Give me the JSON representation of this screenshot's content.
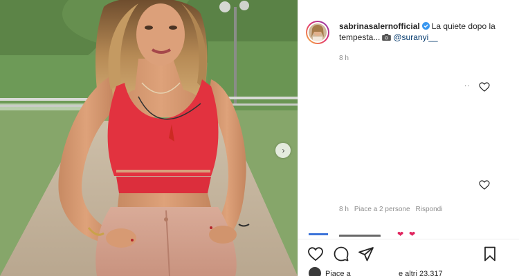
{
  "post": {
    "username": "sabrinasalernofficial",
    "caption_part1": "La quiete dopo la tempesta...",
    "mention": "@suranyi__",
    "timestamp": "8 h"
  },
  "comment": {
    "timestamp": "8 h",
    "likes": "Piace a 2 persone",
    "reply": "Rispondi"
  },
  "likes": {
    "prefix": "Piace a",
    "suffix": "e altri 23.317"
  },
  "icons": {
    "verified": "verified-badge-icon",
    "camera": "camera-icon",
    "next": "chevron-right-icon",
    "like": "heart-icon",
    "comment": "comment-icon",
    "share": "send-icon",
    "save": "bookmark-icon"
  },
  "colors": {
    "accent_blue": "#3897f0",
    "link": "#00376b",
    "heart": "#e0245e",
    "muted": "#8e8e8e"
  }
}
